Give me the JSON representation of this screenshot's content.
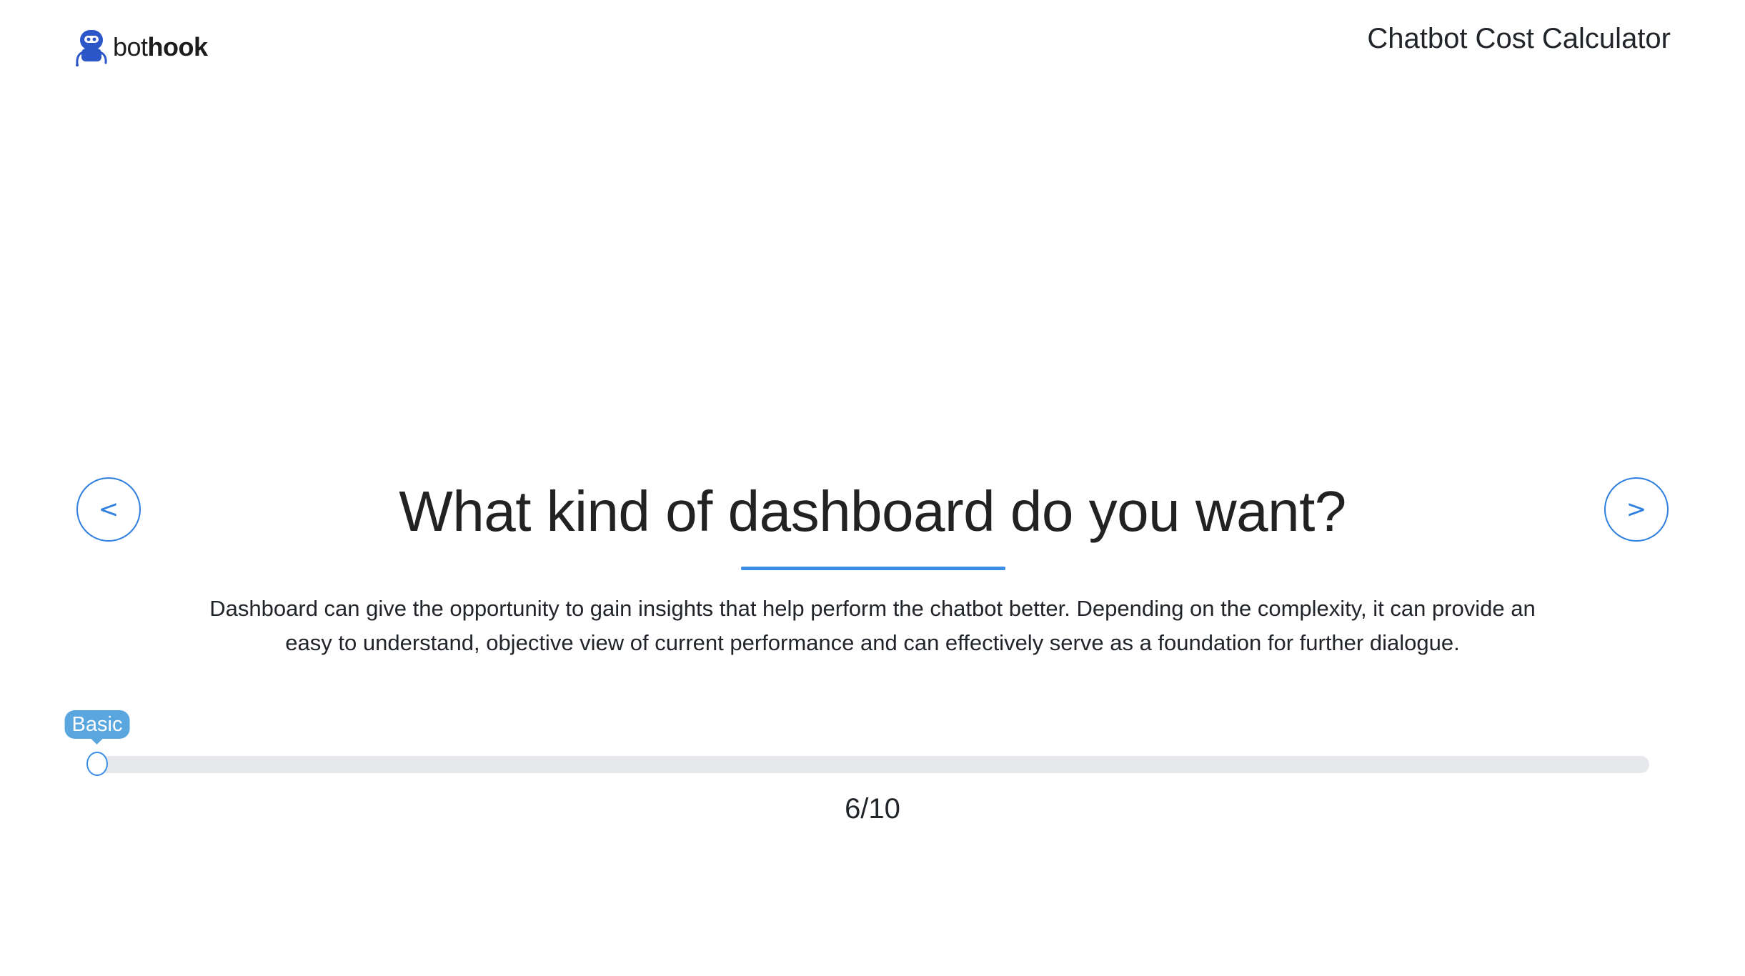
{
  "header": {
    "logo_light": "bot",
    "logo_bold": "hook",
    "title": "Chatbot Cost Calculator"
  },
  "question": {
    "title": "What kind of dashboard do you want?",
    "description": "Dashboard can give the opportunity to gain insights that help perform the chatbot better. Depending on the complexity, it can provide an easy to understand, objective view of current performance and can effectively serve as a foundation for further dialogue."
  },
  "nav": {
    "prev_label": "<",
    "next_label": ">"
  },
  "slider": {
    "tooltip": "Basic",
    "value_fraction": 0
  },
  "progress": {
    "text": "6/10"
  },
  "colors": {
    "accent": "#2f7fe0",
    "tooltip": "#5aa6de",
    "track": "#e6e8eb",
    "logo": "#2b56c7"
  },
  "icons": {
    "logo": "robot-logo-icon"
  }
}
